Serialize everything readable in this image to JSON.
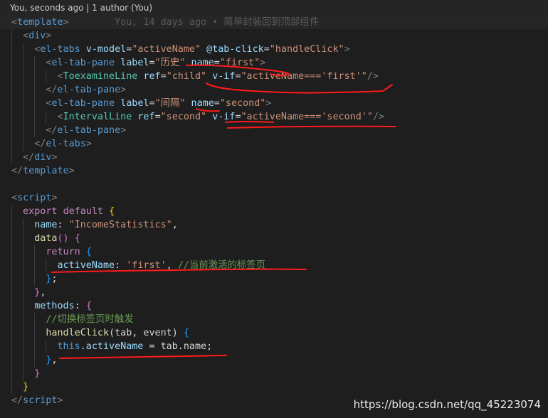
{
  "blame_header": "You, seconds ago | 1 author (You)",
  "inline_blame": "You, 14 days ago • 简单封装回到顶部组件",
  "code": {
    "tag_template": "template",
    "tag_div": "div",
    "tag_el_tabs": "el-tabs",
    "tag_el_tab_pane": "el-tab-pane",
    "comp_toexamine": "ToexamineLine",
    "comp_interval": "IntervalLine",
    "tag_script": "script",
    "attr_v_model": "v-model",
    "val_activeName": "\"activeName\"",
    "attr_tab_click": "@tab-click",
    "val_handleClick": "\"handleClick\"",
    "attr_label": "label",
    "val_label_history": "\"历史\"",
    "val_label_interval": "\"间隔\"",
    "attr_name": "name",
    "val_first": "\"first\"",
    "val_second": "\"second\"",
    "attr_ref": "ref",
    "val_child": "\"child\"",
    "val_ref_second": "\"second\"",
    "attr_v_if": "v-if",
    "val_vif_first": "\"activeName==='first'\"",
    "val_vif_second": "\"activeName==='second'\"",
    "kw_export": "export",
    "kw_default": "default",
    "prop_name": "name",
    "str_income": "\"IncomeStatistics\"",
    "fn_data": "data",
    "kw_return": "return",
    "prop_activeName": "activeName",
    "str_first": "'first'",
    "cmt_current_tab": "//当前激活的标签页",
    "prop_methods": "methods",
    "cmt_switch": "//切换标签页时触发",
    "fn_handleClick": "handleClick",
    "params": "(tab, event)",
    "kw_this": "this",
    "member_activeName": ".activeName",
    "assign_rhs": " = tab.name;"
  },
  "watermark": "https://blog.csdn.net/qq_45223074",
  "colors": {
    "background": "#1e1e1e",
    "annotation_red": "#ff1a1a"
  }
}
